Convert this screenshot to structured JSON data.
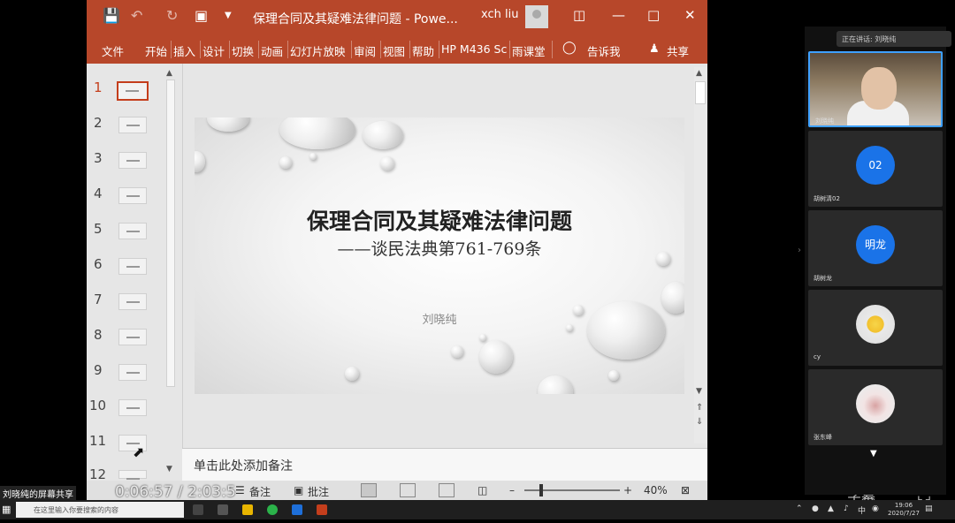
{
  "window": {
    "title": "保理合同及其疑难法律问题 - Powe...",
    "user": "xch liu"
  },
  "ribbon": {
    "tabs": [
      "文件",
      "开始",
      "插入",
      "设计",
      "切换",
      "动画",
      "幻灯片放映",
      "审阅",
      "视图",
      "帮助",
      "HP M436 Sc",
      "雨课堂",
      "告诉我",
      "共享"
    ]
  },
  "thumbnails": {
    "numbers": [
      "1",
      "2",
      "3",
      "4",
      "5",
      "6",
      "7",
      "8",
      "9",
      "10",
      "11",
      "12"
    ],
    "active_index": 0
  },
  "slide": {
    "title": "保理合同及其疑难法律问题",
    "subtitle": "——谈民法典第761-769条",
    "author": "刘晓纯"
  },
  "notes": {
    "placeholder": "单击此处添加备注"
  },
  "statusbar": {
    "notes_label": "备注",
    "comments_label": "批注",
    "zoom_minus": "–",
    "zoom_plus": "+",
    "zoom": "40%"
  },
  "video": {
    "time": "0:06:57  /  2:03:5",
    "subtitles_label": "字幕",
    "screenshare_label": "刘晓纯的屏幕共享"
  },
  "meeting": {
    "speaking_label": "正在讲话: 刘晓纯",
    "participants": [
      {
        "name": "刘晓纯",
        "avatar_text": ""
      },
      {
        "name": "胡树清02",
        "avatar_text": "02"
      },
      {
        "name": "胡树龙",
        "avatar_text": "明龙"
      },
      {
        "name": "cy",
        "avatar_text": ""
      },
      {
        "name": "张东峰",
        "avatar_text": ""
      }
    ]
  },
  "taskbar": {
    "search_placeholder": "在这里输入你要搜索的内容",
    "time": "19:06",
    "date": "2020/7/27"
  },
  "colors": {
    "ppt_accent": "#b7472a",
    "meeting_avatar_blue": "#1a73e8"
  }
}
